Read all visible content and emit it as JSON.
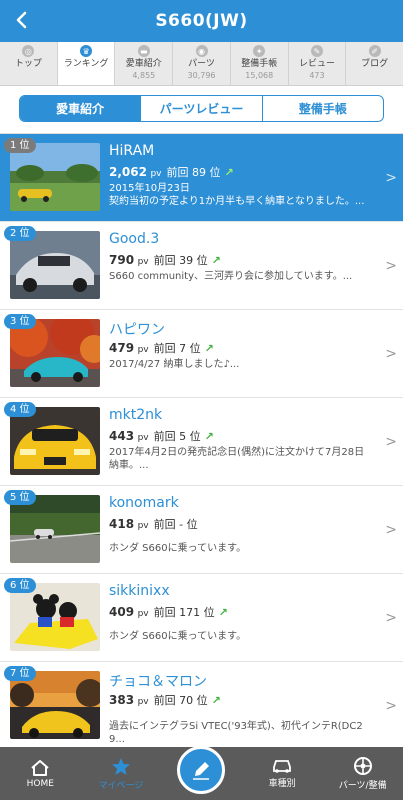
{
  "header": {
    "title": "S660(JW)"
  },
  "tabs": [
    {
      "label": "トップ",
      "count": ""
    },
    {
      "label": "ランキング",
      "count": ""
    },
    {
      "label": "愛車紹介",
      "count": "4,855"
    },
    {
      "label": "パーツ",
      "count": "30,796"
    },
    {
      "label": "整備手帳",
      "count": "15,068"
    },
    {
      "label": "レビュー",
      "count": "473"
    },
    {
      "label": "ブログ",
      "count": ""
    }
  ],
  "segments": [
    "愛車紹介",
    "パーツレビュー",
    "整備手帳"
  ],
  "rankings": [
    {
      "rank": "1 位",
      "name": "HiRAM",
      "pv": "2,062",
      "pv_unit": "pv",
      "prev": "前回 89 位",
      "trend": "up",
      "date": "2015年10月23日",
      "desc": "契約当初の予定より1か月半も早く納車となりました。..."
    },
    {
      "rank": "2 位",
      "name": "Good.3",
      "pv": "790",
      "pv_unit": "pv",
      "prev": "前回 39 位",
      "trend": "up",
      "date": "",
      "desc": "S660 community、三河弄り会に参加しています。..."
    },
    {
      "rank": "3 位",
      "name": "ハピワン",
      "pv": "479",
      "pv_unit": "pv",
      "prev": "前回 7 位",
      "trend": "up",
      "date": "",
      "desc": "2017/4/27 納車しました♪..."
    },
    {
      "rank": "4 位",
      "name": "mkt2nk",
      "pv": "443",
      "pv_unit": "pv",
      "prev": "前回 5 位",
      "trend": "up",
      "date": "",
      "desc": "2017年4月2日の発売記念日(偶然)に注文かけて7月28日納車。..."
    },
    {
      "rank": "5 位",
      "name": "konomark",
      "pv": "418",
      "pv_unit": "pv",
      "prev": "前回 - 位",
      "trend": "none",
      "date": "",
      "desc": "ホンダ S660に乗っています。"
    },
    {
      "rank": "6 位",
      "name": "sikkinixx",
      "pv": "409",
      "pv_unit": "pv",
      "prev": "前回 171 位",
      "trend": "up",
      "date": "",
      "desc": "ホンダ S660に乗っています。"
    },
    {
      "rank": "7 位",
      "name": "チョコ＆マロン",
      "pv": "383",
      "pv_unit": "pv",
      "prev": "前回 70 位",
      "trend": "up",
      "date": "",
      "desc": "過去にインテグラSi VTEC('93年式)、初代インテR(DC2 9..."
    }
  ],
  "bottom_nav": [
    {
      "label": "HOME",
      "icon": "home-icon"
    },
    {
      "label": "マイページ",
      "icon": "star-icon"
    },
    {
      "label": "",
      "icon": "pen-icon"
    },
    {
      "label": "車種別",
      "icon": "car-icon"
    },
    {
      "label": "パーツ/整備",
      "icon": "wheel-icon"
    }
  ],
  "colors": {
    "primary": "#2d8fd5",
    "bottom_nav": "#5b5b5b",
    "trend_up": "#3fb23f"
  }
}
